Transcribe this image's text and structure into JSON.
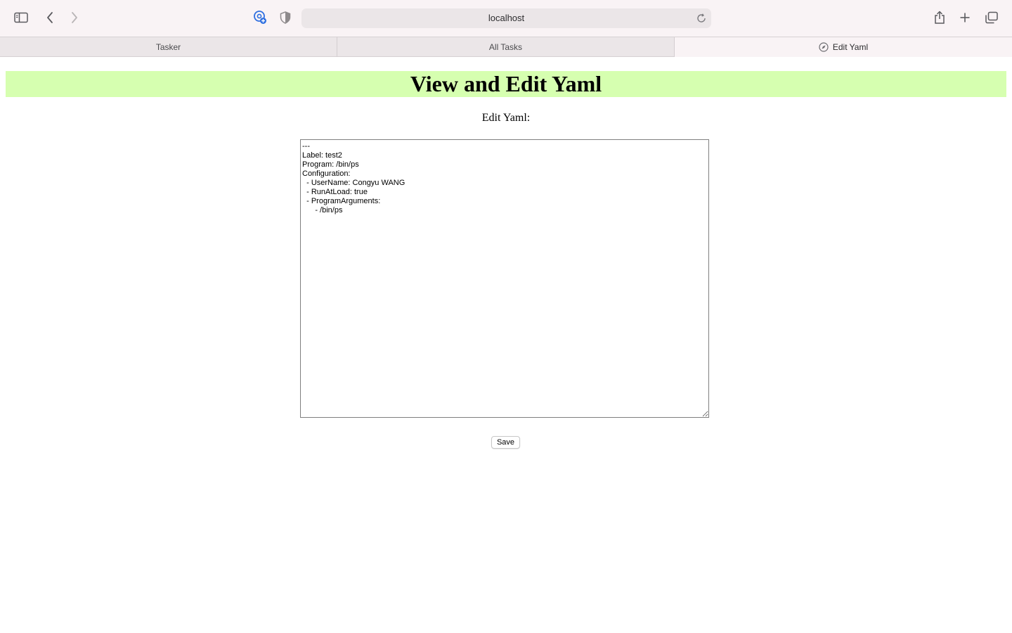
{
  "browser": {
    "address": "localhost",
    "toolbar_icons": [
      "sidebar-icon",
      "back-icon",
      "forward-icon",
      "extension-icon",
      "shield-icon",
      "reload-icon",
      "share-icon",
      "new-tab-icon",
      "tab-overview-icon"
    ]
  },
  "tabs": [
    {
      "label": "Tasker",
      "active": false
    },
    {
      "label": "All Tasks",
      "active": false
    },
    {
      "label": "Edit Yaml",
      "active": true,
      "icon": "compass-icon"
    }
  ],
  "page": {
    "heading": "View and Edit Yaml",
    "heading_bg": "#d6ffb0",
    "edit_label": "Edit Yaml:",
    "yaml_content": "---\nLabel: test2\nProgram: /bin/ps\nConfiguration:\n  - UserName: Congyu WANG\n  - RunAtLoad: true\n  - ProgramArguments:\n      - /bin/ps",
    "save_label": "Save"
  }
}
